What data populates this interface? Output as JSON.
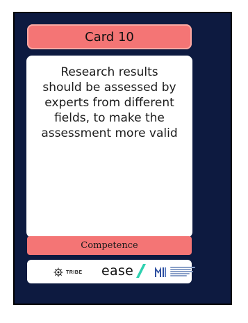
{
  "card": {
    "title": "Card 10",
    "statement": "Research results should be assessed by experts from different fields, to make the assessment more valid",
    "category": "Competence"
  },
  "logos": {
    "tribe": "TRIBE",
    "ease": "ease",
    "ease_slash_color": "#2fd1b0",
    "university_icon": "university-crest-icon"
  },
  "colors": {
    "frame": "#0d1a40",
    "accent": "#f47575",
    "card": "#ffffff"
  }
}
